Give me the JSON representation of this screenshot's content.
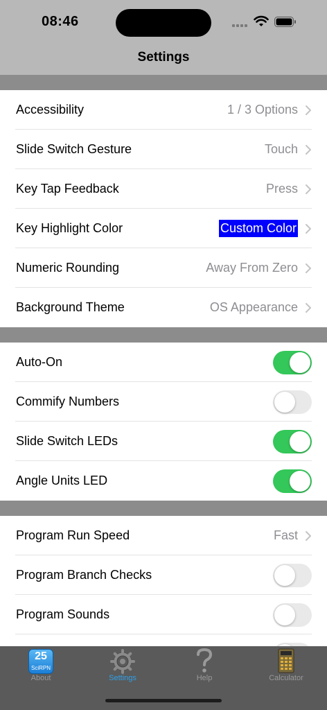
{
  "status_bar": {
    "time": "08:46"
  },
  "nav": {
    "title": "Settings"
  },
  "section1": [
    {
      "label": "Accessibility",
      "value": "1 / 3 Options"
    },
    {
      "label": "Slide Switch Gesture",
      "value": "Touch"
    },
    {
      "label": "Key Tap Feedback",
      "value": "Press"
    },
    {
      "label": "Key Highlight Color",
      "value": "Custom Color"
    },
    {
      "label": "Numeric Rounding",
      "value": "Away From Zero"
    },
    {
      "label": "Background Theme",
      "value": "OS Appearance"
    }
  ],
  "section2": [
    {
      "label": "Auto-On",
      "on": true
    },
    {
      "label": "Commify Numbers",
      "on": false
    },
    {
      "label": "Slide Switch LEDs",
      "on": true
    },
    {
      "label": "Angle Units LED",
      "on": true
    }
  ],
  "section3": [
    {
      "label": "Program Run Speed",
      "value": "Fast"
    },
    {
      "label": "Program Branch Checks",
      "on": false
    },
    {
      "label": "Program Sounds",
      "on": false
    }
  ],
  "tabs": [
    {
      "label": "About",
      "icon": "app-icon",
      "icon_number": "25",
      "icon_subtext": "SciRPN"
    },
    {
      "label": "Settings",
      "icon": "gear-icon"
    },
    {
      "label": "Help",
      "icon": "question-icon"
    },
    {
      "label": "Calculator",
      "icon": "calculator-icon"
    }
  ],
  "colors": {
    "accent": "#2ea0e8",
    "toggle_on": "#34c759",
    "highlight": "#0000ff"
  }
}
